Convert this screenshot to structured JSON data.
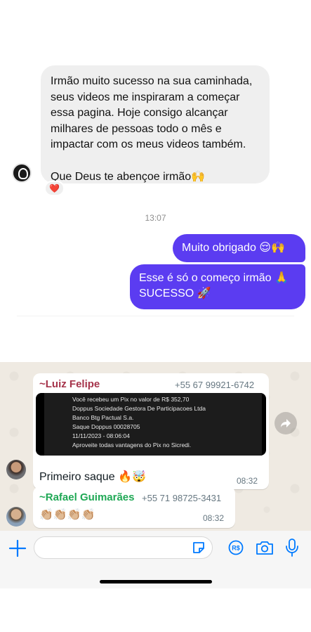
{
  "instagram": {
    "incoming_message": {
      "lines": [
        "Irmão muito sucesso na sua caminhada,",
        "seus videos me inspiraram a começar",
        "essa pagina. Hoje consigo alcançar",
        "milhares de pessoas todo o mês e",
        "impactar com os meus videos também."
      ],
      "blessing": "Que Deus te abençoe irmão🙌",
      "reaction": "❤️"
    },
    "timestamp": "13:07",
    "outgoing_messages": [
      {
        "line1": "Muito obrigado 😌🙌"
      },
      {
        "line1": "Esse é só o começo irmão 🙏",
        "line2": "SUCESSO 🚀"
      }
    ]
  },
  "whatsapp": {
    "messages": [
      {
        "sender": "~Luiz Felipe",
        "sender_color": "#a5334a",
        "phone": "+55 67 99921-6742",
        "pix_receipt": [
          "Você recebeu um Pix no valor de R$ 352,70",
          "Doppus Sociedade Gestora De Participacoes Ltda",
          "Banco Btg Pactual S.a.",
          "Saque Doppus 00028705",
          "11/11/2023 - 08:06:04",
          "Aproveite todas vantagens do Pix no Sicredi."
        ],
        "text": "Primeiro saque 🔥🤯",
        "time": "08:32"
      },
      {
        "sender": "~Rafael Guimarães",
        "sender_color": "#1fa855",
        "phone": "+55 71 98725-3431",
        "text": "👏🏼👏🏼👏🏼👏🏼",
        "time": "08:32"
      }
    ],
    "accent": "#007aff"
  }
}
